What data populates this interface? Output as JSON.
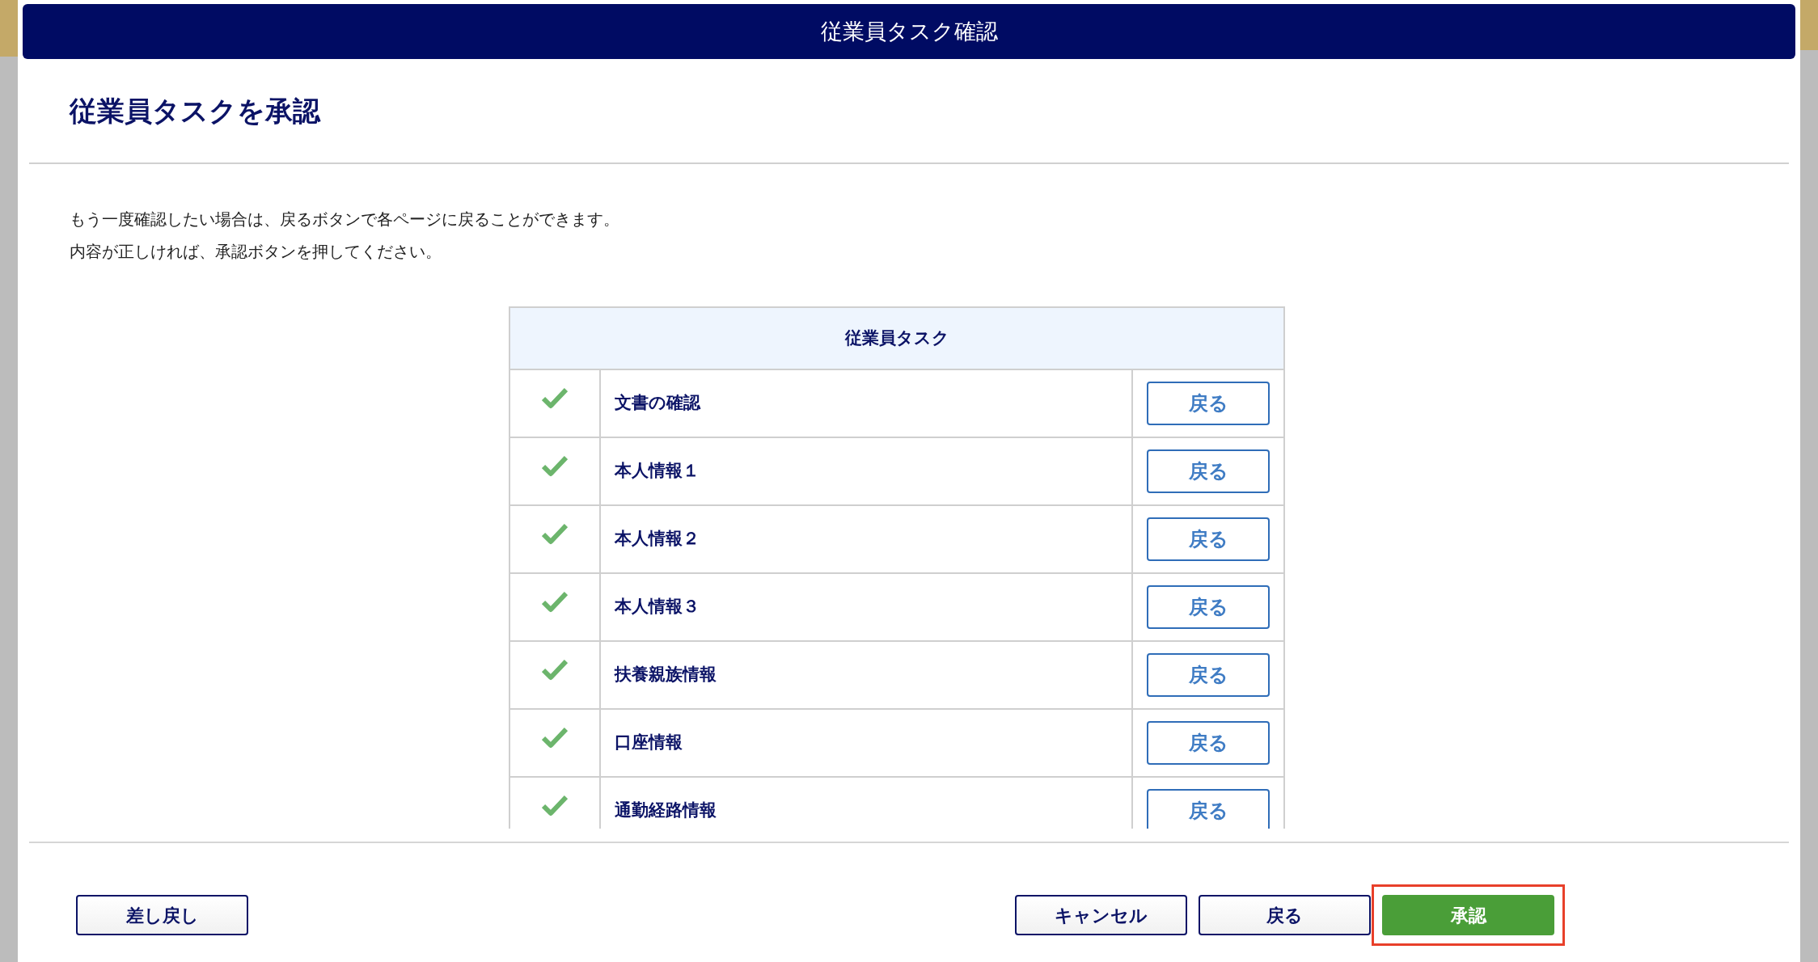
{
  "dialog": {
    "title": "従業員タスク確認",
    "heading": "従業員タスクを承認",
    "messages": [
      "もう一度確認したい場合は、戻るボタンで各ページに戻ることができます。",
      "内容が正しければ、承認ボタンを押してください。"
    ]
  },
  "task_table": {
    "header": "従業員タスク",
    "rows": [
      {
        "done": true,
        "label": "文書の確認",
        "button": "戻る"
      },
      {
        "done": true,
        "label": "本人情報１",
        "button": "戻る"
      },
      {
        "done": true,
        "label": "本人情報２",
        "button": "戻る"
      },
      {
        "done": true,
        "label": "本人情報３",
        "button": "戻る"
      },
      {
        "done": true,
        "label": "扶養親族情報",
        "button": "戻る"
      },
      {
        "done": true,
        "label": "口座情報",
        "button": "戻る"
      },
      {
        "done": true,
        "label": "通勤経路情報",
        "button": "戻る"
      }
    ]
  },
  "footer": {
    "left_buttons": [
      {
        "label": "差し戻し",
        "kind": "outline",
        "highlighted": false
      }
    ],
    "right_buttons": [
      {
        "label": "キャンセル",
        "kind": "outline",
        "highlighted": false
      },
      {
        "label": "戻る",
        "kind": "outline",
        "highlighted": false
      },
      {
        "label": "承認",
        "kind": "primary",
        "highlighted": true
      }
    ]
  }
}
